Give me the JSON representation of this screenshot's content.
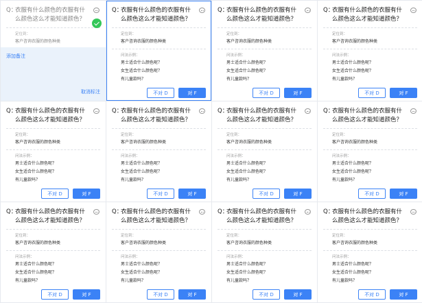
{
  "annotated_card": {
    "q_prefix": "Q：",
    "question": "衣服有什么颜色的衣服有什么颜色这么才能知道颜色？",
    "position_label": "定位到：",
    "position_value": "客户咨询衣服的颜色种类",
    "add_note": "添加备注",
    "cancel_mark": "取消标注"
  },
  "card_template": {
    "q_prefix": "Q：",
    "question": "衣服有什么颜色的衣服有什么颜色这么才能知道颜色？",
    "position_label": "定位到：",
    "position_value": "客户咨询衣服的颜色种类",
    "example_label": "问法示例：",
    "examples": [
      "男士适合什么颜色呢？",
      "女生适合什么颜色呢？",
      "有儿童款吗？"
    ],
    "no_button": "不对 D",
    "yes_button": "对 F"
  },
  "cards": [
    {
      "selected": true
    },
    {
      "selected": false
    },
    {
      "selected": false
    },
    {
      "selected": false
    },
    {
      "selected": false
    },
    {
      "selected": false
    },
    {
      "selected": false
    },
    {
      "selected": false
    },
    {
      "selected": false
    },
    {
      "selected": false
    },
    {
      "selected": false
    }
  ],
  "colors": {
    "accent": "#3b82f6",
    "success": "#34c759",
    "annotated_bg": "#eaf2fb"
  },
  "icons": [
    "chat-bubble-icon",
    "check-circle-icon"
  ]
}
